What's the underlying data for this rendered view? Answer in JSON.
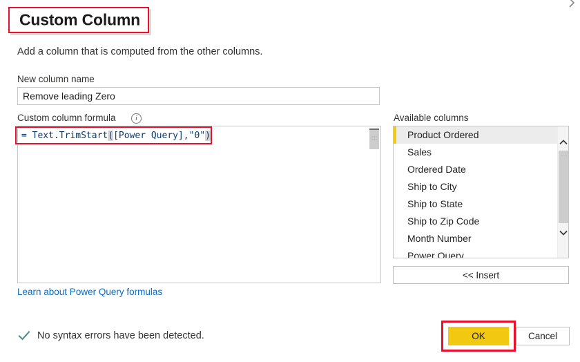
{
  "dialog": {
    "title": "Custom Column",
    "description": "Add a column that is computed from the other columns."
  },
  "corner": {
    "chevron_icon": "chevron-right-icon"
  },
  "new_column": {
    "label": "New column name",
    "value": "Remove leading Zero",
    "placeholder": ""
  },
  "formula": {
    "label": "Custom column formula",
    "info_icon": "info-icon",
    "info_glyph": "i",
    "prefix": "= Text.TrimStart",
    "open_paren": "(",
    "body": "[Power Query],\"0\"",
    "close_paren": ")",
    "full_text": "= Text.TrimStart([Power Query],\"0\")",
    "scrollbar_name": "formula-scrollbar"
  },
  "learn_link": {
    "label": "Learn about Power Query formulas"
  },
  "status": {
    "icon": "checkmark-icon",
    "text": "No syntax errors have been detected."
  },
  "available_columns": {
    "label": "Available columns",
    "items": [
      {
        "label": "Product Ordered",
        "selected": true
      },
      {
        "label": "Sales",
        "selected": false
      },
      {
        "label": "Ordered Date",
        "selected": false
      },
      {
        "label": "Ship to City",
        "selected": false
      },
      {
        "label": "Ship to State",
        "selected": false
      },
      {
        "label": "Ship to Zip Code",
        "selected": false
      },
      {
        "label": "Month Number",
        "selected": false
      },
      {
        "label": "Power Query",
        "selected": false
      }
    ],
    "scroll_up_icon": "chevron-up-icon",
    "scroll_down_icon": "chevron-down-icon"
  },
  "buttons": {
    "insert": "<< Insert",
    "ok": "OK",
    "cancel": "Cancel"
  },
  "colors": {
    "accent_yellow": "#f2c811",
    "annotation_red": "#e8112d",
    "link_blue": "#0b6cc4",
    "formula_text": "#0b3c6e",
    "check_teal": "#4e8f87"
  }
}
